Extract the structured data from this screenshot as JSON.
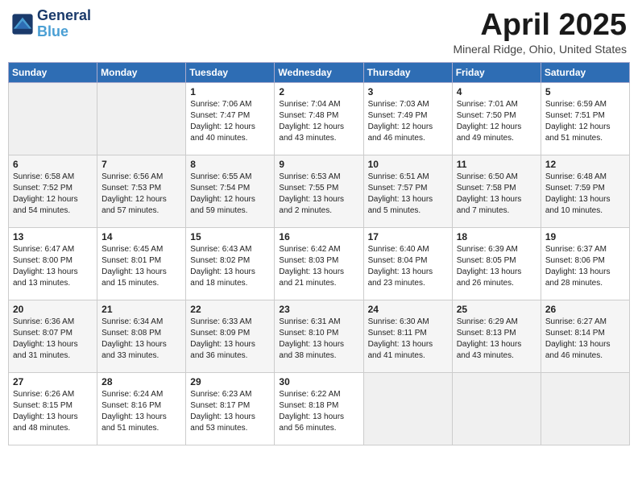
{
  "header": {
    "logo_general": "General",
    "logo_blue": "Blue",
    "title": "April 2025",
    "location": "Mineral Ridge, Ohio, United States"
  },
  "days_of_week": [
    "Sunday",
    "Monday",
    "Tuesday",
    "Wednesday",
    "Thursday",
    "Friday",
    "Saturday"
  ],
  "weeks": [
    [
      {
        "day": "",
        "content": ""
      },
      {
        "day": "",
        "content": ""
      },
      {
        "day": "1",
        "content": "Sunrise: 7:06 AM\nSunset: 7:47 PM\nDaylight: 12 hours and 40 minutes."
      },
      {
        "day": "2",
        "content": "Sunrise: 7:04 AM\nSunset: 7:48 PM\nDaylight: 12 hours and 43 minutes."
      },
      {
        "day": "3",
        "content": "Sunrise: 7:03 AM\nSunset: 7:49 PM\nDaylight: 12 hours and 46 minutes."
      },
      {
        "day": "4",
        "content": "Sunrise: 7:01 AM\nSunset: 7:50 PM\nDaylight: 12 hours and 49 minutes."
      },
      {
        "day": "5",
        "content": "Sunrise: 6:59 AM\nSunset: 7:51 PM\nDaylight: 12 hours and 51 minutes."
      }
    ],
    [
      {
        "day": "6",
        "content": "Sunrise: 6:58 AM\nSunset: 7:52 PM\nDaylight: 12 hours and 54 minutes."
      },
      {
        "day": "7",
        "content": "Sunrise: 6:56 AM\nSunset: 7:53 PM\nDaylight: 12 hours and 57 minutes."
      },
      {
        "day": "8",
        "content": "Sunrise: 6:55 AM\nSunset: 7:54 PM\nDaylight: 12 hours and 59 minutes."
      },
      {
        "day": "9",
        "content": "Sunrise: 6:53 AM\nSunset: 7:55 PM\nDaylight: 13 hours and 2 minutes."
      },
      {
        "day": "10",
        "content": "Sunrise: 6:51 AM\nSunset: 7:57 PM\nDaylight: 13 hours and 5 minutes."
      },
      {
        "day": "11",
        "content": "Sunrise: 6:50 AM\nSunset: 7:58 PM\nDaylight: 13 hours and 7 minutes."
      },
      {
        "day": "12",
        "content": "Sunrise: 6:48 AM\nSunset: 7:59 PM\nDaylight: 13 hours and 10 minutes."
      }
    ],
    [
      {
        "day": "13",
        "content": "Sunrise: 6:47 AM\nSunset: 8:00 PM\nDaylight: 13 hours and 13 minutes."
      },
      {
        "day": "14",
        "content": "Sunrise: 6:45 AM\nSunset: 8:01 PM\nDaylight: 13 hours and 15 minutes."
      },
      {
        "day": "15",
        "content": "Sunrise: 6:43 AM\nSunset: 8:02 PM\nDaylight: 13 hours and 18 minutes."
      },
      {
        "day": "16",
        "content": "Sunrise: 6:42 AM\nSunset: 8:03 PM\nDaylight: 13 hours and 21 minutes."
      },
      {
        "day": "17",
        "content": "Sunrise: 6:40 AM\nSunset: 8:04 PM\nDaylight: 13 hours and 23 minutes."
      },
      {
        "day": "18",
        "content": "Sunrise: 6:39 AM\nSunset: 8:05 PM\nDaylight: 13 hours and 26 minutes."
      },
      {
        "day": "19",
        "content": "Sunrise: 6:37 AM\nSunset: 8:06 PM\nDaylight: 13 hours and 28 minutes."
      }
    ],
    [
      {
        "day": "20",
        "content": "Sunrise: 6:36 AM\nSunset: 8:07 PM\nDaylight: 13 hours and 31 minutes."
      },
      {
        "day": "21",
        "content": "Sunrise: 6:34 AM\nSunset: 8:08 PM\nDaylight: 13 hours and 33 minutes."
      },
      {
        "day": "22",
        "content": "Sunrise: 6:33 AM\nSunset: 8:09 PM\nDaylight: 13 hours and 36 minutes."
      },
      {
        "day": "23",
        "content": "Sunrise: 6:31 AM\nSunset: 8:10 PM\nDaylight: 13 hours and 38 minutes."
      },
      {
        "day": "24",
        "content": "Sunrise: 6:30 AM\nSunset: 8:11 PM\nDaylight: 13 hours and 41 minutes."
      },
      {
        "day": "25",
        "content": "Sunrise: 6:29 AM\nSunset: 8:13 PM\nDaylight: 13 hours and 43 minutes."
      },
      {
        "day": "26",
        "content": "Sunrise: 6:27 AM\nSunset: 8:14 PM\nDaylight: 13 hours and 46 minutes."
      }
    ],
    [
      {
        "day": "27",
        "content": "Sunrise: 6:26 AM\nSunset: 8:15 PM\nDaylight: 13 hours and 48 minutes."
      },
      {
        "day": "28",
        "content": "Sunrise: 6:24 AM\nSunset: 8:16 PM\nDaylight: 13 hours and 51 minutes."
      },
      {
        "day": "29",
        "content": "Sunrise: 6:23 AM\nSunset: 8:17 PM\nDaylight: 13 hours and 53 minutes."
      },
      {
        "day": "30",
        "content": "Sunrise: 6:22 AM\nSunset: 8:18 PM\nDaylight: 13 hours and 56 minutes."
      },
      {
        "day": "",
        "content": ""
      },
      {
        "day": "",
        "content": ""
      },
      {
        "day": "",
        "content": ""
      }
    ]
  ]
}
